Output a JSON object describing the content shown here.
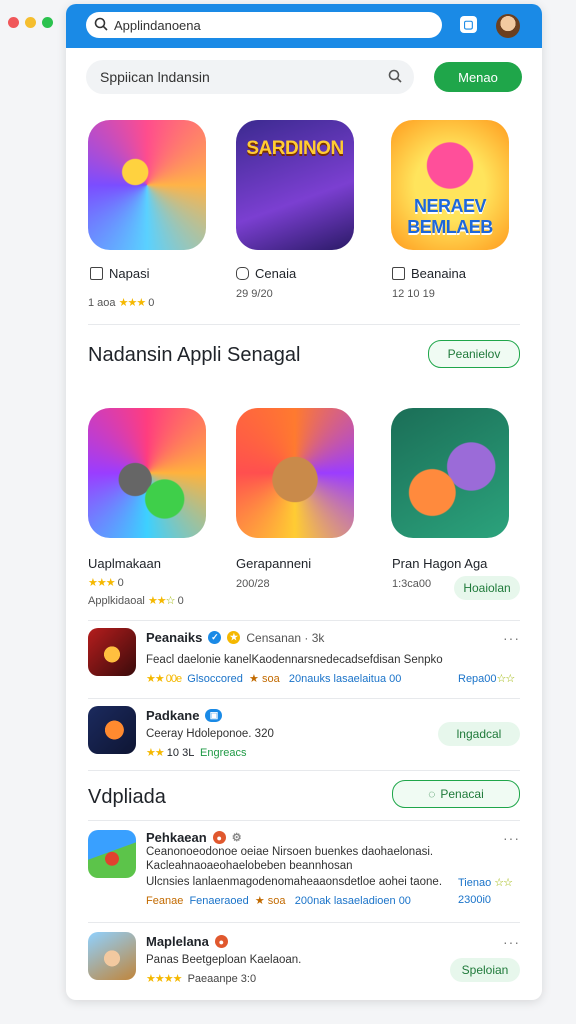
{
  "browser": {
    "url": "Applindanoena"
  },
  "search": {
    "value": "Sppiican lndansin",
    "button": "Menao"
  },
  "featured": [
    {
      "tile_text": "SARDINON",
      "name": "Napasi",
      "meta": "1 aoa",
      "stars": "★★★",
      "extra": "0"
    },
    {
      "tile_text": "",
      "name": "Cenaia",
      "meta": "29 9/20"
    },
    {
      "tile_text": "NERAEV BEMLAEB",
      "name": "Beanaina",
      "meta": "12 10 19"
    }
  ],
  "section1": {
    "title": "Nadansin Appli  Senagal",
    "button": "Peanielov"
  },
  "grid2": [
    {
      "name": "Uaplmakaan",
      "stars": "★★★",
      "extra": "0",
      "meta": "Applkidaoal",
      "stars2": "★★",
      "stars2_o": "☆",
      "extra2": "0"
    },
    {
      "name": "Gerapanneni",
      "meta": "200/28"
    },
    {
      "name": "Pran Hagon Aga",
      "meta": "1:3ca00",
      "button": "Hoaiolan"
    }
  ],
  "list1": [
    {
      "title": "Peanaiks",
      "sub": "Censanan  · 3k",
      "line": "Feacl daelonie  kanelKaodennarsnedecadsefdisan  Senpko",
      "meta_a": "★★ 00e",
      "meta_b": "Glsoccored",
      "meta_c": "★ soa",
      "meta_d": "20nauks lasaelaitua 00",
      "meta_e": "Repa00",
      "meta_f": "☆☆"
    },
    {
      "title": "Padkane",
      "sub": "",
      "line": "Ceeray Hdoleponoe.  320",
      "stars": "★★",
      "meta_a": "10 3L",
      "meta_b": "Engreacs",
      "button": "lngadcal"
    }
  ],
  "section2": {
    "title": "Vdpliada",
    "button": "Penacai"
  },
  "list2": [
    {
      "title": "Pehkaean",
      "line1": "Ceanonoeodonoe oeiae  Nirsoen buenkes daohaelonasi.",
      "line2": "Kacleahnaoaeohaelobeben beannhosan",
      "line3": "Ulcnsies  lanlaenmagodenomaheaaonsdetloe  aohei taone.",
      "meta_a": "Feanae",
      "meta_b": "Fenaeraoed",
      "meta_c": "★ soa",
      "meta_d": "200nak  lasaeladioen 00",
      "meta_e": "2300i0",
      "right_top": "Tienao",
      "right_stars": "☆☆"
    },
    {
      "title": "Maplelana",
      "line": "Panas  Beetgeploan  Kaelaoan.",
      "stars": "★★★★",
      "meta": "Paeaanpe  3:0",
      "button": "Speloian"
    }
  ]
}
